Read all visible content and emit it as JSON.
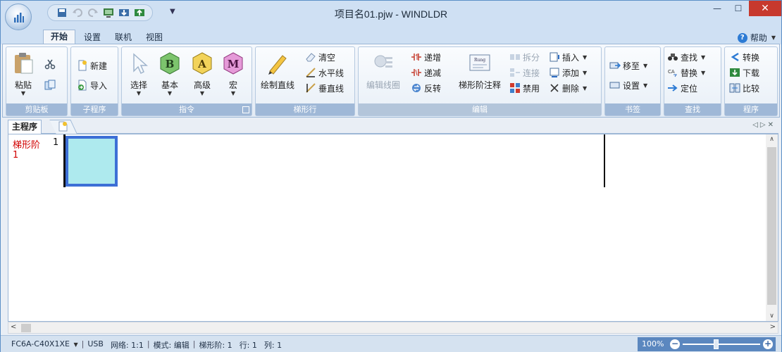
{
  "window": {
    "title": "项目名01.pjw - WINDLDR"
  },
  "ribbon_tabs": [
    {
      "label": "开始",
      "active": true
    },
    {
      "label": "设置",
      "active": false
    },
    {
      "label": "联机",
      "active": false
    },
    {
      "label": "视图",
      "active": false
    }
  ],
  "help": {
    "label": "帮助"
  },
  "groups": {
    "clipboard": {
      "title": "剪贴板",
      "paste": "粘贴"
    },
    "subroutine": {
      "title": "子程序",
      "new": "新建",
      "import": "导入"
    },
    "instruction": {
      "title": "指令",
      "select": "选择",
      "basic": "基本",
      "advanced": "高级",
      "macro": "宏"
    },
    "ladder_row": {
      "title": "梯形行",
      "draw_line": "绘制直线",
      "clear": "清空",
      "horizontal": "水平线",
      "vertical": "垂直线"
    },
    "edit": {
      "title": "编辑",
      "edit_coil": "编辑线圈",
      "increment": "递增",
      "decrement": "递减",
      "invert": "反转",
      "rung_comment": "梯形阶注释",
      "split": "拆分",
      "connect": "连接",
      "disable": "禁用",
      "insert": "插入",
      "add": "添加",
      "delete": "删除"
    },
    "bookmark": {
      "title": "书签",
      "move_to": "移至",
      "set": "设置"
    },
    "find": {
      "title": "查找",
      "find": "查找",
      "replace": "替换",
      "locate": "定位"
    },
    "program": {
      "title": "程序",
      "convert": "转换",
      "download": "下载",
      "compare": "比较"
    }
  },
  "colors": {
    "accent": "#3d6fd6",
    "cursor_fill": "#aeeaee",
    "rung_label": "#d10000",
    "close": "#c7392d"
  },
  "document": {
    "tab_label": "主程序"
  },
  "editor": {
    "rung_label": "梯形阶",
    "rung_number": "1",
    "step_number": "1"
  },
  "status": {
    "plc_type": "FC6A-C40X1XE",
    "connection": "USB",
    "network": "网络: 1:1",
    "mode": "模式: 编辑",
    "rung": "梯形阶: 1",
    "row": "行: 1",
    "col": "列: 1",
    "zoom": "100%",
    "zoom_level_percent": 100
  }
}
